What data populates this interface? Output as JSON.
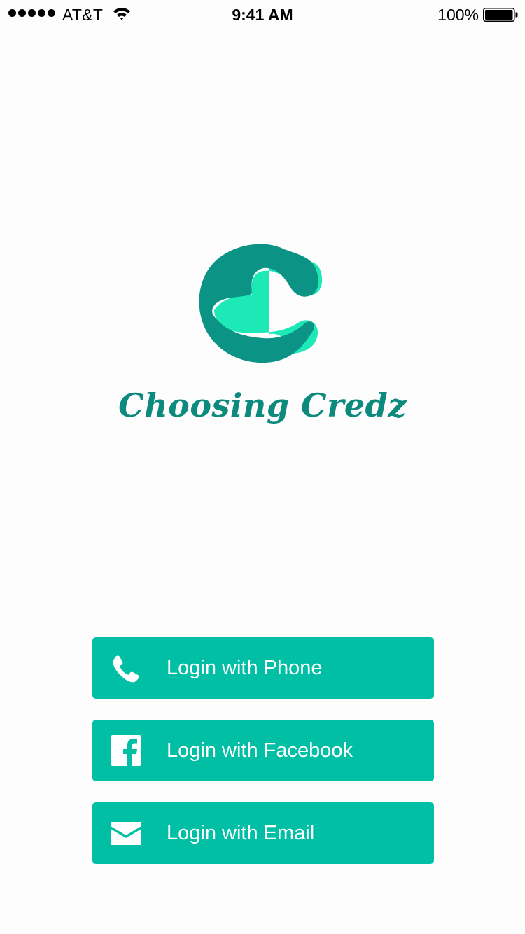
{
  "status_bar": {
    "carrier": "AT&T",
    "time": "9:41 AM",
    "battery_percent": "100%",
    "signal_bars": 5,
    "icons": [
      "signal-dots-icon",
      "wifi-icon",
      "battery-icon"
    ]
  },
  "brand": {
    "name": "Choosing Credz",
    "logo_icon": "choosing-credz-logo",
    "colors": {
      "dark_teal": "#0b9486",
      "light_teal": "#1de9b6",
      "text": "#0b8a7d"
    }
  },
  "login": {
    "phone": {
      "label": "Login with Phone",
      "icon": "phone-icon"
    },
    "facebook": {
      "label": "Login with Facebook",
      "icon": "facebook-icon"
    },
    "email": {
      "label": "Login with Email",
      "icon": "envelope-icon"
    },
    "button_color": "#00bfa5"
  }
}
